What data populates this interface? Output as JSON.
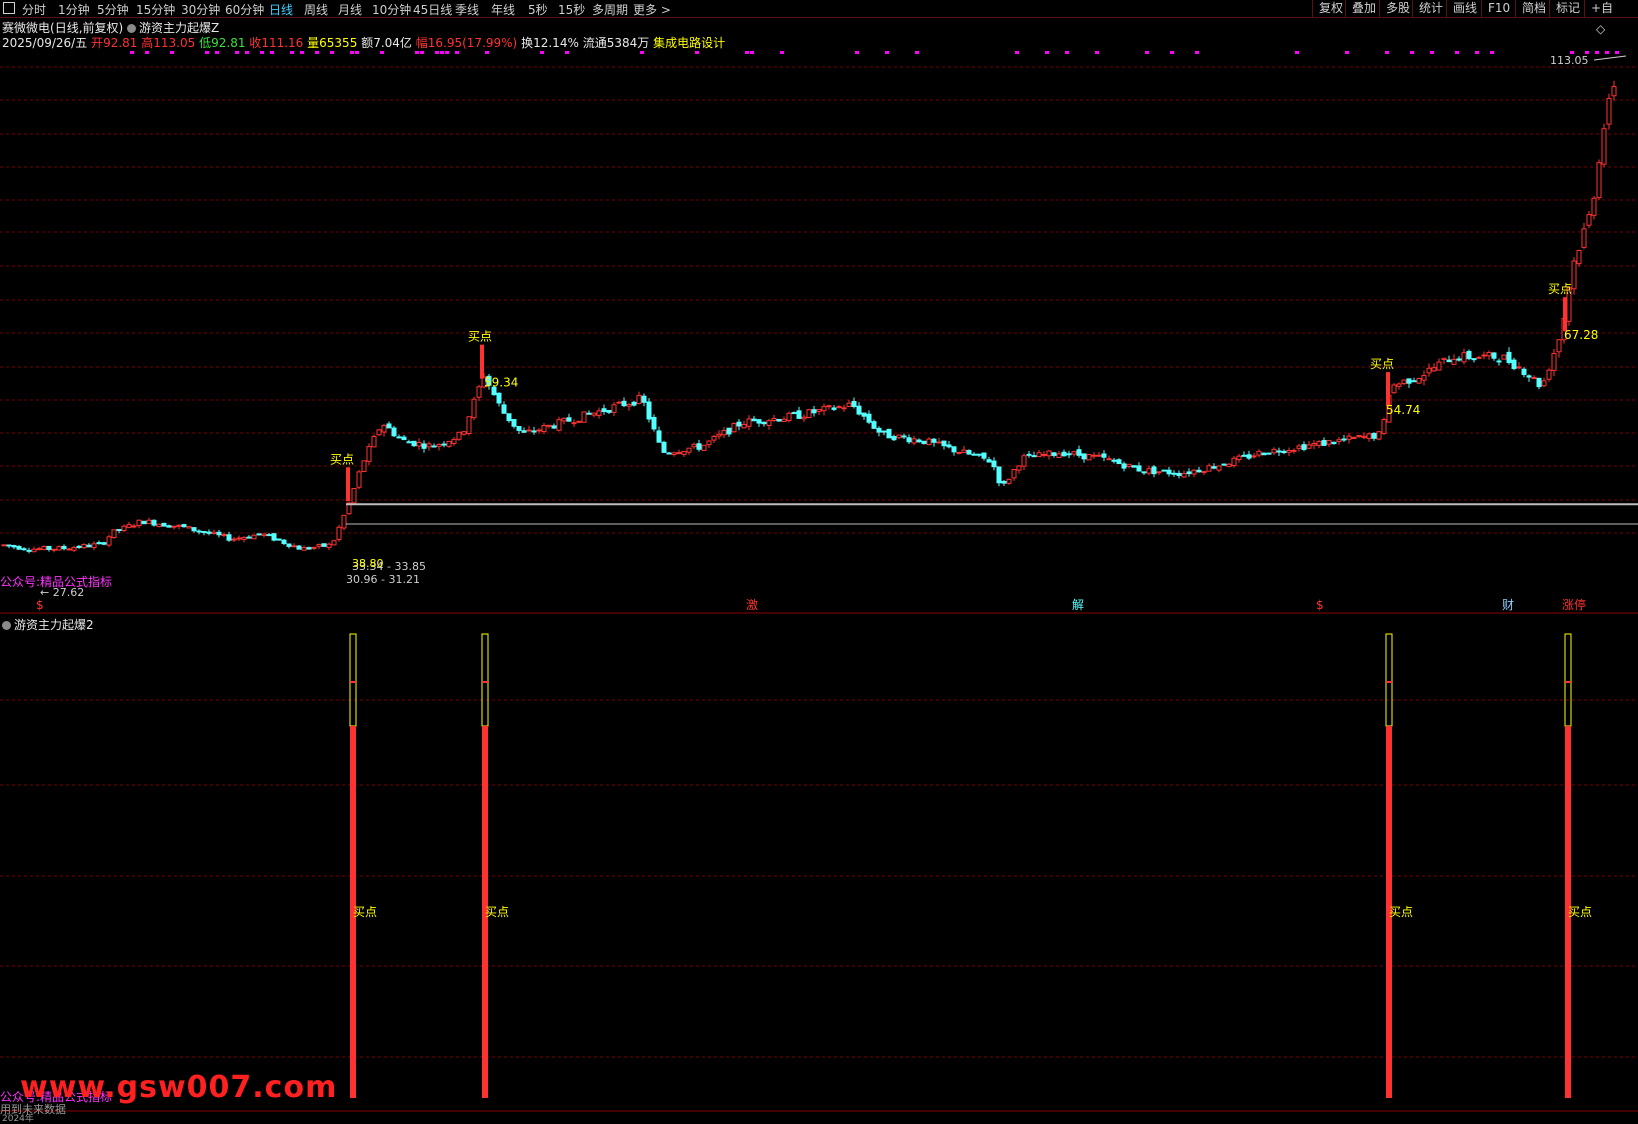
{
  "toolbar": {
    "period_tabs": [
      "分时",
      "1分钟",
      "5分钟",
      "15分钟",
      "30分钟",
      "60分钟",
      "日线",
      "周线",
      "月线",
      "10分钟",
      "45日线",
      "季线",
      "年线",
      "5秒",
      "15秒",
      "多周期",
      "更多 >"
    ],
    "active_tab": "日线",
    "right_buttons": [
      "复权",
      "叠加",
      "多股",
      "统计",
      "画线",
      "F10",
      "简档",
      "标记",
      "+自"
    ]
  },
  "header": {
    "stock_name": "赛微微电",
    "period_info": "(日线,前复权)",
    "indicator_name": "游资主力起爆Z",
    "date": "2025/09/26/五",
    "open_label": "开",
    "open": "92.81",
    "high_label": "高",
    "high": "113.05",
    "low_label": "低",
    "low": "92.81",
    "close_label": "收",
    "close": "111.16",
    "volume_label": "量",
    "volume": "65355",
    "amount_label": "额",
    "amount": "7.04亿",
    "change_label": "幅",
    "change": "16.95(17.99%)",
    "turnover_label": "换",
    "turnover": "12.14%",
    "float_label": "流通",
    "float": "5384万",
    "sector": "集成电路设计"
  },
  "main_labels": {
    "max_price": "113.05",
    "low_price": "27.62",
    "buy_label": "买点",
    "range1": "30.96 - 31.21",
    "range2": "33.34 - 33.85",
    "range2_value": "38.80",
    "buy_prices": [
      "59.34",
      "54.74",
      "67.28"
    ],
    "watermark_main": "公众号:精品公式指标",
    "event_markers": [
      "$",
      "激",
      "解",
      "$",
      "财",
      "涨停"
    ],
    "sub_indicator": "游资主力起爆2",
    "watermark_sub": "公众号:精品公式指标",
    "site_watermark": "www.gsw007.com",
    "future_data_note": "用到未来数据",
    "date_axis_first": "2024年"
  },
  "colors": {
    "up": "#ff3232",
    "down": "#54ffff",
    "buy_text": "#ffff00",
    "grid": "#7a0000",
    "magenta": "#ff00ff",
    "active_tab": "#3fd2ff"
  },
  "chart_data": {
    "type": "candlestick",
    "title": "赛微微电 日线",
    "price_range": [
      27.62,
      113.05
    ],
    "buy_signals": [
      {
        "label": "买点",
        "price": 38.8
      },
      {
        "label": "买点",
        "price": 59.34
      },
      {
        "label": "买点",
        "price": 54.74
      },
      {
        "label": "买点",
        "price": 67.28
      }
    ],
    "last": {
      "open": 92.81,
      "high": 113.05,
      "low": 92.81,
      "close": 111.16,
      "volume": 65355
    }
  }
}
